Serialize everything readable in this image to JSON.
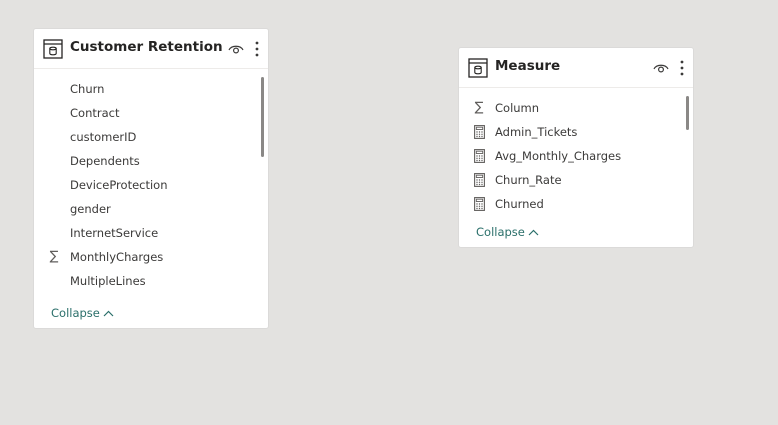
{
  "tables": [
    {
      "title": "Customer Retention",
      "fields": [
        {
          "label": "Churn",
          "icon": ""
        },
        {
          "label": "Contract",
          "icon": ""
        },
        {
          "label": "customerID",
          "icon": ""
        },
        {
          "label": "Dependents",
          "icon": ""
        },
        {
          "label": "DeviceProtection",
          "icon": ""
        },
        {
          "label": "gender",
          "icon": ""
        },
        {
          "label": "InternetService",
          "icon": ""
        },
        {
          "label": "MonthlyCharges",
          "icon": "sigma-icon"
        },
        {
          "label": "MultipleLines",
          "icon": ""
        }
      ],
      "collapse_label": "Collapse"
    },
    {
      "title": "Measure",
      "fields": [
        {
          "label": "Column",
          "icon": "sigma-icon"
        },
        {
          "label": "Admin_Tickets",
          "icon": "calculator-icon"
        },
        {
          "label": "Avg_Monthly_Charges",
          "icon": "calculator-icon"
        },
        {
          "label": "Churn_Rate",
          "icon": "calculator-icon"
        },
        {
          "label": "Churned",
          "icon": "calculator-icon"
        }
      ],
      "collapse_label": "Collapse"
    }
  ],
  "colors": {
    "canvas": "#e3e2e0",
    "card": "#ffffff",
    "collapse_link": "#2a6f6a"
  }
}
